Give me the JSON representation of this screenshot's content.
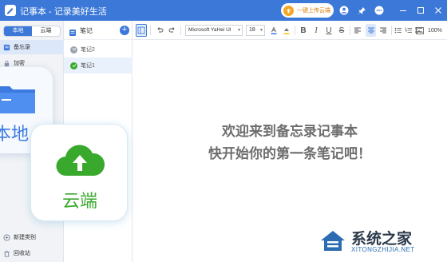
{
  "window": {
    "title": "记事本 - 记录美好生活",
    "upload_button": "一键上传云端"
  },
  "sidebar": {
    "tabs": [
      {
        "label": "本地",
        "active": true
      },
      {
        "label": "云端",
        "active": false
      }
    ],
    "items": [
      {
        "label": "备忘录",
        "icon": "memo-icon",
        "selected": true
      },
      {
        "label": "加密",
        "icon": "lock-icon",
        "selected": false
      }
    ],
    "bottom_items": [
      {
        "label": "新建类别",
        "icon": "add-category-icon"
      },
      {
        "label": "回收站",
        "icon": "trash-icon"
      }
    ]
  },
  "note_list": {
    "title": "笔记",
    "items": [
      {
        "label": "笔记2",
        "icon": "note-gray-icon",
        "selected": false
      },
      {
        "label": "笔记1",
        "icon": "note-green-icon",
        "selected": true
      }
    ]
  },
  "toolbar": {
    "font_family": "Microsoft YaHei UI",
    "font_size": "18",
    "zoom": "100%",
    "icons": [
      "sidebar-toggle-icon",
      "undo-icon",
      "redo-icon",
      "font-color-icon",
      "highlight-icon",
      "bold-icon",
      "italic-icon",
      "underline-icon",
      "strikethrough-icon",
      "align-left-icon",
      "align-center-icon",
      "align-right-icon",
      "bullet-list-icon",
      "numbered-list-icon",
      "checklist-icon",
      "image-icon"
    ]
  },
  "editor": {
    "welcome_line1": "欢迎来到备忘录记事本",
    "welcome_line2": "快开始你的第一条笔记吧！"
  },
  "promo": {
    "local_label": "本地",
    "cloud_label": "云端"
  },
  "watermark": {
    "brand": "系统之家",
    "url": "XITONGZHIJIA.NET"
  },
  "colors": {
    "titlebar": "#3c78d8",
    "accent": "#3c78d8",
    "cloud_green": "#39a92d",
    "upload_orange": "#f5a623"
  }
}
